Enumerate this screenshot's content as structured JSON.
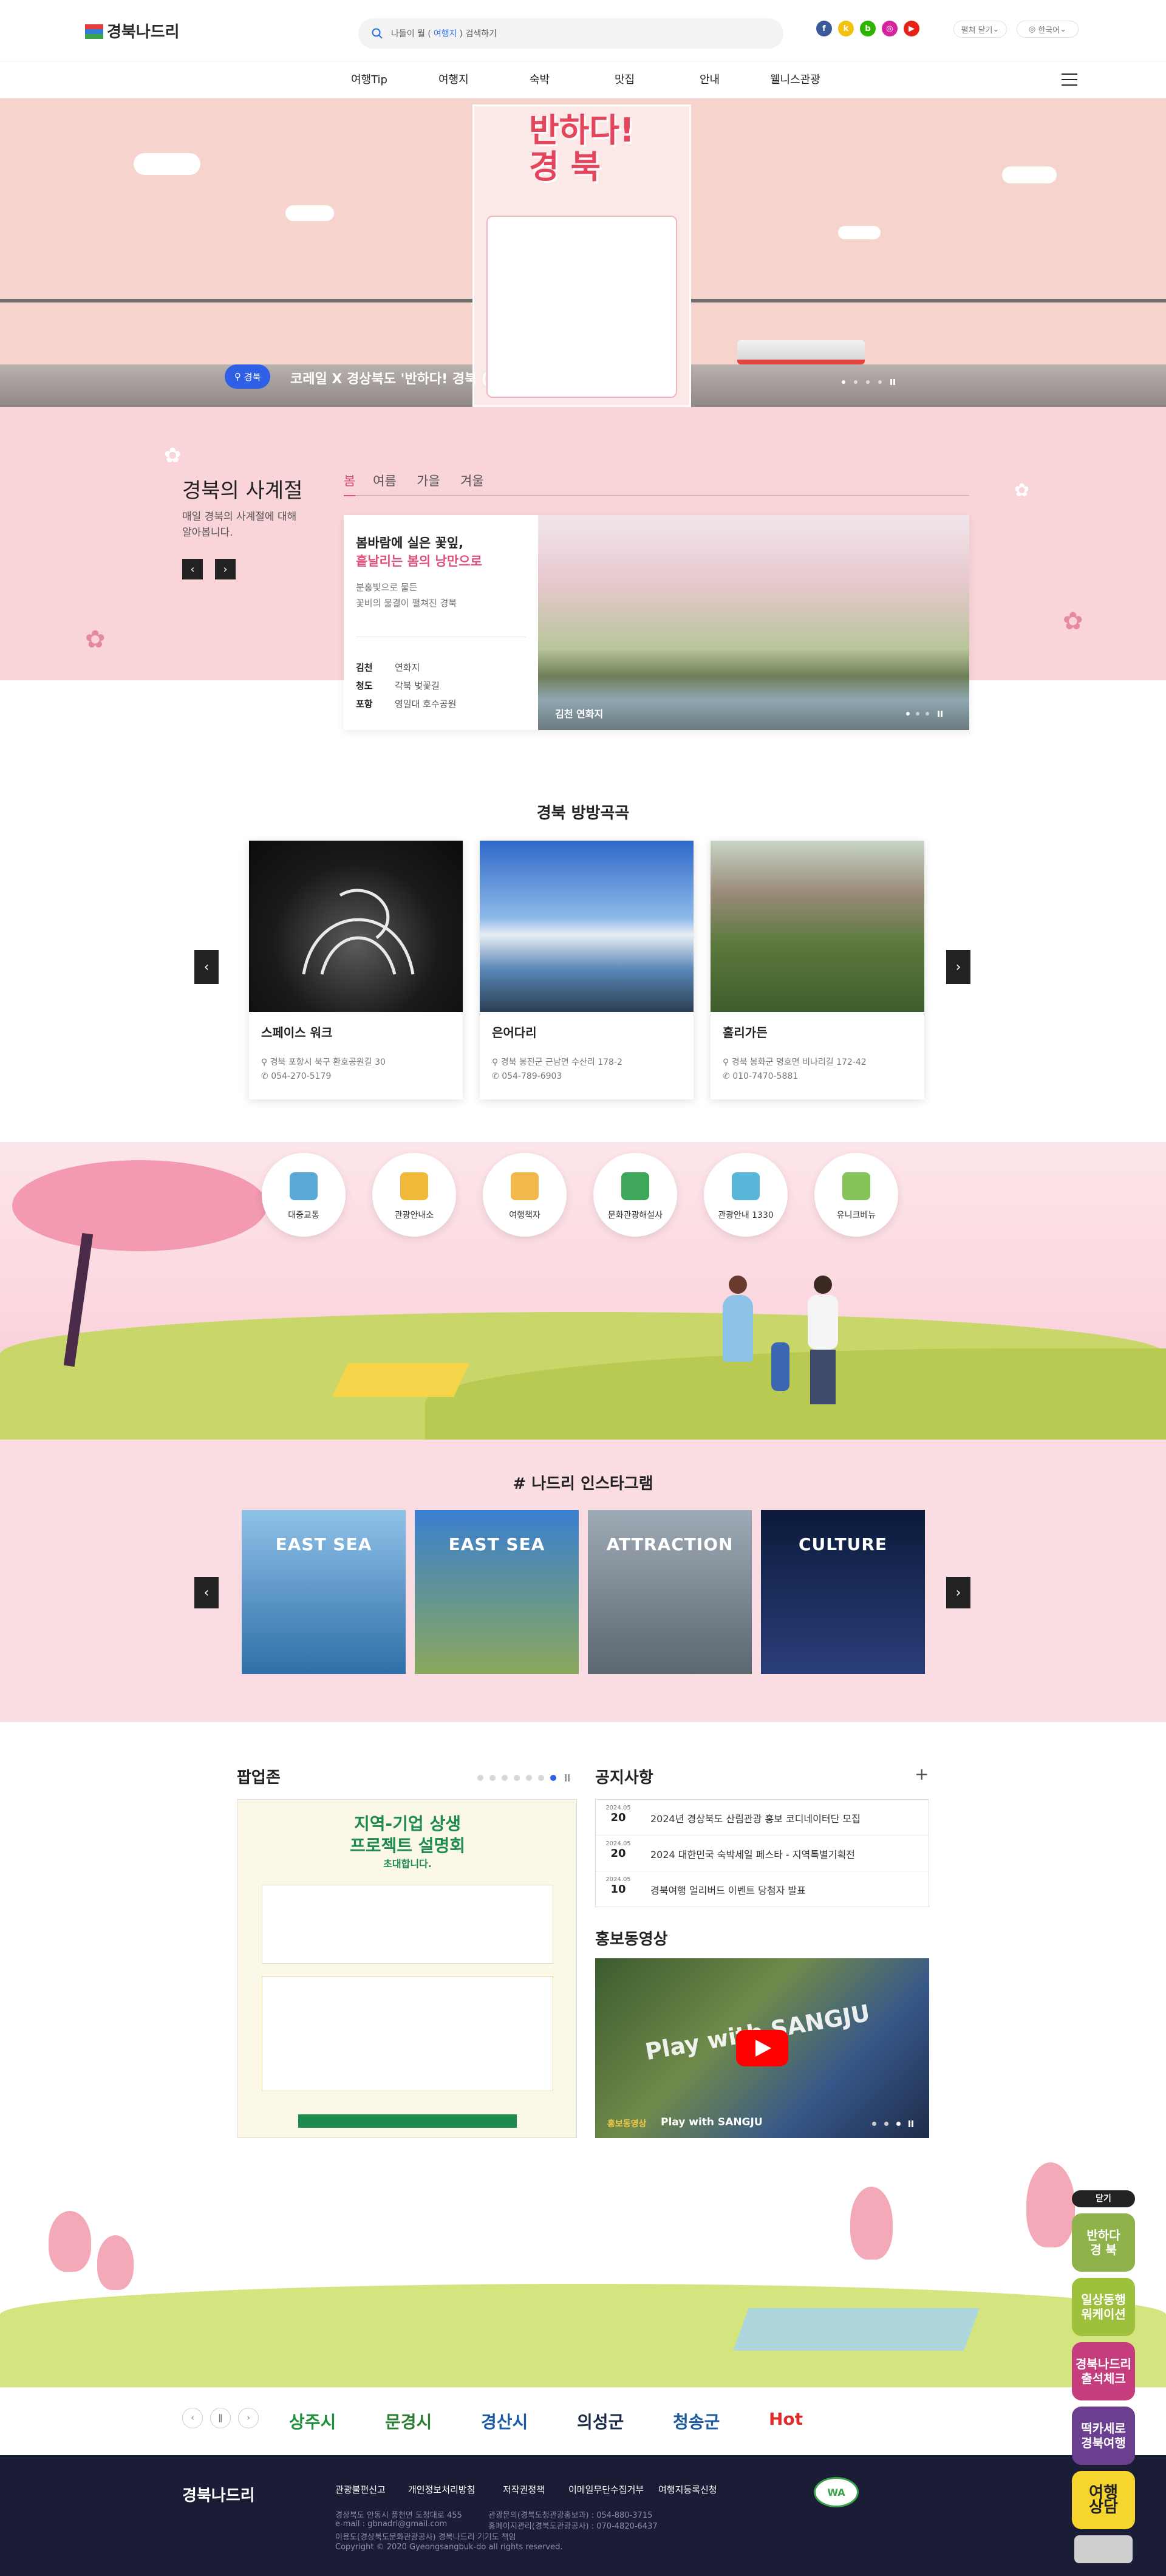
{
  "header": {
    "logo_text": "경북나드리",
    "search": {
      "prefix": "나들이 뭘 (",
      "keyword": "여행지",
      "suffix": ") 검색하기"
    },
    "sns": [
      {
        "name": "facebook",
        "color": "#3b5998",
        "glyph": "f"
      },
      {
        "name": "kakao",
        "color": "#f2c20f",
        "glyph": "k"
      },
      {
        "name": "blog",
        "color": "#2db400",
        "glyph": "b"
      },
      {
        "name": "instagram",
        "color": "#d6249f",
        "glyph": "◎"
      },
      {
        "name": "youtube",
        "color": "#e62117",
        "glyph": "▶"
      }
    ],
    "menu_open": "펼쳐 닫기",
    "language": "한국어"
  },
  "gnb": [
    "여행Tip",
    "여행지",
    "숙박",
    "맛집",
    "안내",
    "웰니스관광"
  ],
  "hero": {
    "tag": "경북",
    "title": "코레일 X 경상북도 '반하다! 경북 (시즌 2)'",
    "poster_title": "반하다!\n경 북"
  },
  "season": {
    "title": "경북의 사계절",
    "desc": "매일 경북의 사계절에 대해 알아봅니다.",
    "tabs": [
      "봄",
      "여름",
      "가을",
      "겨울"
    ],
    "active_tab": "봄",
    "headline1": "봄바람에 실은 꽃잎,",
    "headline2": "흩날리는 봄의 낭만으로",
    "sub1": "분홍빛으로 물든",
    "sub2": "꽃비의 물결이 펼쳐진 경북",
    "places": [
      {
        "city": "김천",
        "name": "연화지"
      },
      {
        "city": "청도",
        "name": "각북 벚꽃길"
      },
      {
        "city": "포항",
        "name": "영일대 호수공원"
      }
    ],
    "image_caption": "김천 연화지"
  },
  "attractions": {
    "title": "경북 방방곡곡",
    "items": [
      {
        "name": "스페이스 워크",
        "addr": "경북 포항시 북구 환호공원길 30",
        "tel": "054-270-5179"
      },
      {
        "name": "은어다리",
        "addr": "경북 봉진군 근남면 수산리 178-2",
        "tel": "054-789-6903"
      },
      {
        "name": "홀리가든",
        "addr": "경북 봉화군 명호면 비나리길 172-42",
        "tel": "010-7470-5881"
      }
    ]
  },
  "quick": [
    {
      "label": "대중교통",
      "icon": "bus-icon",
      "color": "#5aa9d6"
    },
    {
      "label": "관광안내소",
      "icon": "info-booth-icon",
      "color": "#f0b93a"
    },
    {
      "label": "여행책자",
      "icon": "book-icon",
      "color": "#f2b84b"
    },
    {
      "label": "문화관광해설사",
      "icon": "headset-icon",
      "color": "#3ea75a"
    },
    {
      "label": "관광안내 1330",
      "icon": "phone-icon",
      "color": "#58b7d8"
    },
    {
      "label": "유니크베뉴",
      "icon": "map-pin-icon",
      "color": "#86c35a"
    }
  ],
  "instagram": {
    "title": "# 나드리 인스타그램",
    "items": [
      {
        "caption": "EAST SEA",
        "colors": [
          "#8fc1e8",
          "#2f6fa8"
        ]
      },
      {
        "caption": "EAST SEA",
        "colors": [
          "#3a7fd0",
          "#8aa85c"
        ]
      },
      {
        "caption": "ATTRACTION",
        "colors": [
          "#9eaab5",
          "#5b6670"
        ]
      },
      {
        "caption": "CULTURE",
        "colors": [
          "#0b1a3a",
          "#2b3f7a"
        ]
      }
    ]
  },
  "popup": {
    "title": "팝업존",
    "heading1": "지역-기업 상생",
    "heading2": "프로젝트 설명회",
    "heading3": "초대합니다."
  },
  "notice": {
    "title": "공지사항",
    "more": "+",
    "items": [
      {
        "ym": "2024.05",
        "d": "20",
        "text": "2024년 경상북도 산림관광 홍보 코디네이터단 모집"
      },
      {
        "ym": "2024.05",
        "d": "20",
        "text": "2024 대한민국 숙박세일 페스타 - 지역특별기획전"
      },
      {
        "ym": "2024.05",
        "d": "10",
        "text": "경북여행 얼리버드 이벤트 당첨자 발표"
      }
    ]
  },
  "video": {
    "title": "홍보동영상",
    "tag": "홍보동영상",
    "caption": "Play with SANGJU",
    "overlay": "Play with SANGJU"
  },
  "sponsors": [
    {
      "name": "상주시",
      "color": "#1b8f3a"
    },
    {
      "name": "문경시",
      "color": "#2b7d35"
    },
    {
      "name": "경산시",
      "color": "#1a5aa8"
    },
    {
      "name": "의성군",
      "color": "#1c2a4a"
    },
    {
      "name": "청송군",
      "color": "#1c5aa0"
    },
    {
      "name": "Hot",
      "color": "#e02a2a"
    }
  ],
  "footer": {
    "links": [
      "관광불편신고",
      "개인정보처리방침",
      "저작권정책",
      "이메일무단수집거부",
      "여행지등록신청"
    ],
    "addr": "경상북도 안동시 풍천면 도청대로 455",
    "email": "e-mail : gbnadri@gmail.com",
    "editor": "이용도(경상북도문화관광공사) 경북나드리 기기도 책임",
    "copyright": "Copyright © 2020 Gyeongsangbuk-do all rights reserved.",
    "tel1": "관광문의(경북도청관광홍보과) : 054-880-3715",
    "tel2": "홍페이지관리(경북도관광공사) : 070-4820-6437",
    "badge": "WA"
  },
  "quickbar": {
    "close": "닫기",
    "items": [
      {
        "label": "반하다\n경 북",
        "bg": "#8fb24a",
        "color": "#fff"
      },
      {
        "label": "일상동행\n워케이션",
        "bg": "#9ec13d",
        "color": "#fff"
      },
      {
        "label": "경북나드리\n출석체크",
        "bg": "#c63d7e",
        "color": "#fff"
      },
      {
        "label": "떡카세로\n경북여행",
        "bg": "#6a3f8f",
        "color": "#fff"
      },
      {
        "label": "여행\n상담",
        "bg": "#f6d52f",
        "color": "#222"
      }
    ]
  }
}
